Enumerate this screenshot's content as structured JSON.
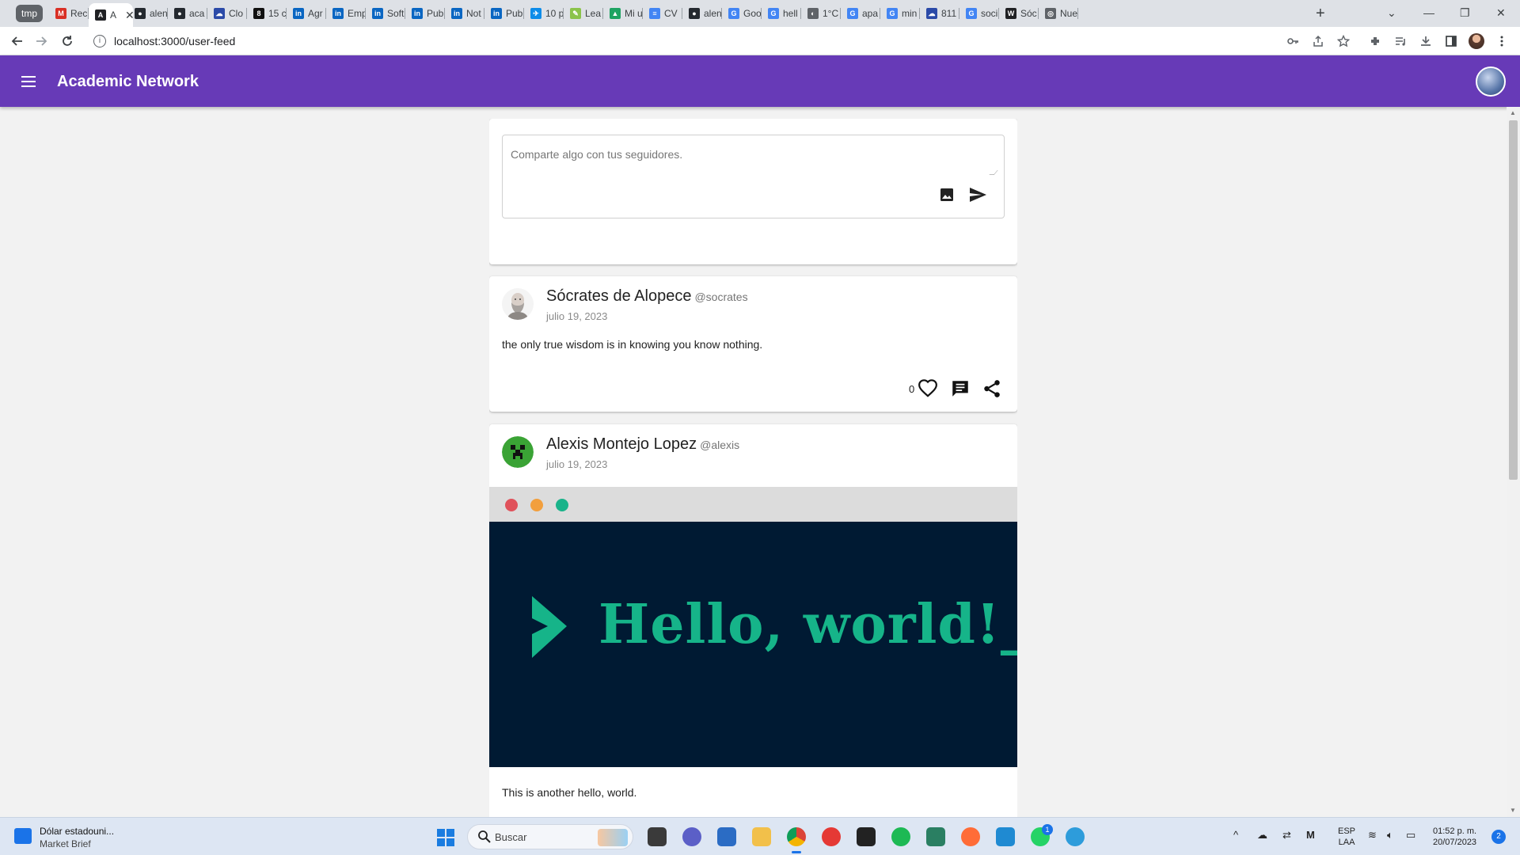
{
  "browser": {
    "tab_group_label": "tmp",
    "tabs": [
      {
        "label": "Rec",
        "color": "#d93025",
        "glyph": "M"
      },
      {
        "label": "A",
        "color": "#202124",
        "glyph": "A",
        "active": true
      },
      {
        "label": "alen",
        "color": "#24292f",
        "glyph": "●"
      },
      {
        "label": "aca",
        "color": "#24292f",
        "glyph": "●"
      },
      {
        "label": "Clo",
        "color": "#2b4aa8",
        "glyph": "☁"
      },
      {
        "label": "15 c",
        "color": "#111111",
        "glyph": "8"
      },
      {
        "label": "Agr",
        "color": "#0a66c2",
        "glyph": "in"
      },
      {
        "label": "Emp",
        "color": "#0a66c2",
        "glyph": "in"
      },
      {
        "label": "Soft",
        "color": "#0a66c2",
        "glyph": "in"
      },
      {
        "label": "Pub",
        "color": "#0a66c2",
        "glyph": "in"
      },
      {
        "label": "Not",
        "color": "#0a66c2",
        "glyph": "in"
      },
      {
        "label": "Pub",
        "color": "#0a66c2",
        "glyph": "in"
      },
      {
        "label": "10 p",
        "color": "#0d8ce9",
        "glyph": "✈"
      },
      {
        "label": "Lea",
        "color": "#8bc34a",
        "glyph": "✎"
      },
      {
        "label": "Mi u",
        "color": "#1ea362",
        "glyph": "▲"
      },
      {
        "label": "CV",
        "color": "#4285f4",
        "glyph": "≡"
      },
      {
        "label": "alen",
        "color": "#24292f",
        "glyph": "●"
      },
      {
        "label": "Goo",
        "color": "#4285f4",
        "glyph": "G"
      },
      {
        "label": "hell",
        "color": "#4285f4",
        "glyph": "G"
      },
      {
        "label": "1°C",
        "color": "#5f6368",
        "glyph": "◐"
      },
      {
        "label": "apa",
        "color": "#4285f4",
        "glyph": "G"
      },
      {
        "label": "min",
        "color": "#4285f4",
        "glyph": "G"
      },
      {
        "label": "811",
        "color": "#2b4aa8",
        "glyph": "☁"
      },
      {
        "label": "soci",
        "color": "#4285f4",
        "glyph": "G"
      },
      {
        "label": "Sóc",
        "color": "#202124",
        "glyph": "W"
      },
      {
        "label": "Nue",
        "color": "#5f6368",
        "glyph": "◎"
      }
    ],
    "new_tab_label": "+",
    "url": "localhost:3000/user-feed"
  },
  "app": {
    "title": "Academic Network",
    "accent": "#673ab7"
  },
  "composer": {
    "placeholder": "Comparte algo con tus seguidores."
  },
  "posts": [
    {
      "author": "Sócrates de Alopece",
      "handle": "@socrates",
      "date": "julio 19, 2023",
      "text": "the only true wisdom is in knowing you know nothing.",
      "likes": "0"
    },
    {
      "author": "Alexis Montejo Lopez",
      "handle": "@alexis",
      "date": "julio 19, 2023",
      "image_text": "Hello, world!_",
      "text": "This is another hello, world."
    }
  ],
  "taskbar": {
    "widget_title": "Dólar estadouni...",
    "widget_subtitle": "Market Brief",
    "search_placeholder": "Buscar",
    "lang_line1": "ESP",
    "lang_line2": "LAA",
    "time": "01:52 p. m.",
    "date": "20/07/2023",
    "whatsapp_badge": "1",
    "notifications": "2"
  }
}
